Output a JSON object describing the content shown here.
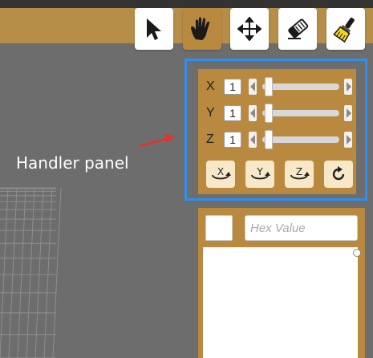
{
  "toolbar": {
    "tools": [
      {
        "name": "select",
        "icon": "cursor-arrow-icon",
        "active": false
      },
      {
        "name": "pan",
        "icon": "hand-icon",
        "active": true
      },
      {
        "name": "move",
        "icon": "move-arrows-icon",
        "active": false
      },
      {
        "name": "erase",
        "icon": "eraser-icon",
        "active": false
      },
      {
        "name": "paint",
        "icon": "paint-brush-icon",
        "active": false
      }
    ]
  },
  "handler_panel": {
    "axes": [
      {
        "label": "X",
        "value": "1",
        "slider_fraction": 0.03
      },
      {
        "label": "Y",
        "value": "1",
        "slider_fraction": 0.03
      },
      {
        "label": "Z",
        "value": "1",
        "slider_fraction": 0.03
      }
    ],
    "rotate_buttons": [
      {
        "name": "rotate-x",
        "icon": "rotate-x-icon",
        "axis_letter": "X"
      },
      {
        "name": "rotate-y",
        "icon": "rotate-y-icon",
        "axis_letter": "Y"
      },
      {
        "name": "rotate-z",
        "icon": "rotate-z-icon",
        "axis_letter": "Z"
      },
      {
        "name": "reset-rotation",
        "icon": "refresh-icon",
        "axis_letter": ""
      }
    ]
  },
  "color_panel": {
    "hex_placeholder": "Hex Value",
    "swatch_color": "#ffffff"
  },
  "annotation": {
    "label": "Handler panel",
    "highlight_color": "#2f8ef0",
    "arrow_color": "#e8302a"
  },
  "colors": {
    "toolbar_bg": "#b78e48",
    "panel_bg": "#b8893e",
    "viewport_bg": "#6d6d6d"
  }
}
